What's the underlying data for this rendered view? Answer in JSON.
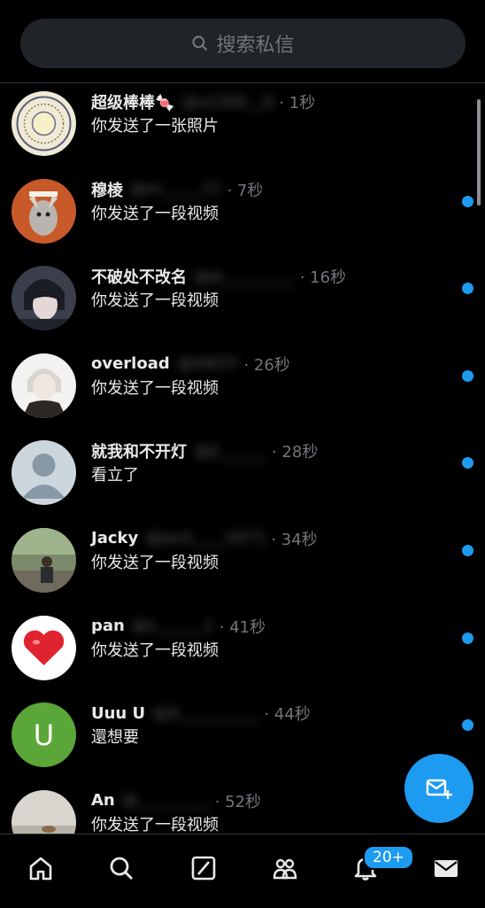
{
  "search": {
    "placeholder": "搜索私信",
    "icon": "search-icon"
  },
  "conversations": [
    {
      "name": "超级棒棒🍬",
      "handle": "@x1560__6",
      "time": "· 1秒",
      "preview": "你发送了一张照片",
      "unread": false
    },
    {
      "name": "穆棱",
      "handle": "@m_____11",
      "time": "· 7秒",
      "preview": "你发送了一段视频",
      "unread": true
    },
    {
      "name": "不破处不改名",
      "handle": "@w_________",
      "time": "· 16秒",
      "preview": "你发送了一段视频",
      "unread": true
    },
    {
      "name": "overload",
      "handle": "@4W3Y",
      "time": "· 26秒",
      "preview": "你发送了一段视频",
      "unread": true
    },
    {
      "name": "就我和不开灯",
      "handle": "@jl______",
      "time": "· 28秒",
      "preview": "看立了",
      "unread": true
    },
    {
      "name": "Jacky",
      "handle": "@jack____h071",
      "time": "· 34秒",
      "preview": "你发送了一段视频",
      "unread": true
    },
    {
      "name": "pan",
      "handle": "@z______1",
      "time": "· 41秒",
      "preview": "你发送了一段视频",
      "unread": true
    },
    {
      "name": "Uuu U",
      "handle": "@A__________",
      "time": "· 44秒",
      "preview": "還想要",
      "unread": true
    },
    {
      "name": "An",
      "handle": "@_________",
      "time": "· 52秒",
      "preview": "你发送了一段视频",
      "unread": false
    }
  ],
  "nav": [
    "home-icon",
    "search-icon",
    "grok-icon",
    "communities-icon",
    "notifications-icon",
    "messages-icon"
  ],
  "notifications_badge": "20+",
  "colors": {
    "accent": "#1d9bf0",
    "background": "#000000",
    "muted": "#71767b"
  }
}
